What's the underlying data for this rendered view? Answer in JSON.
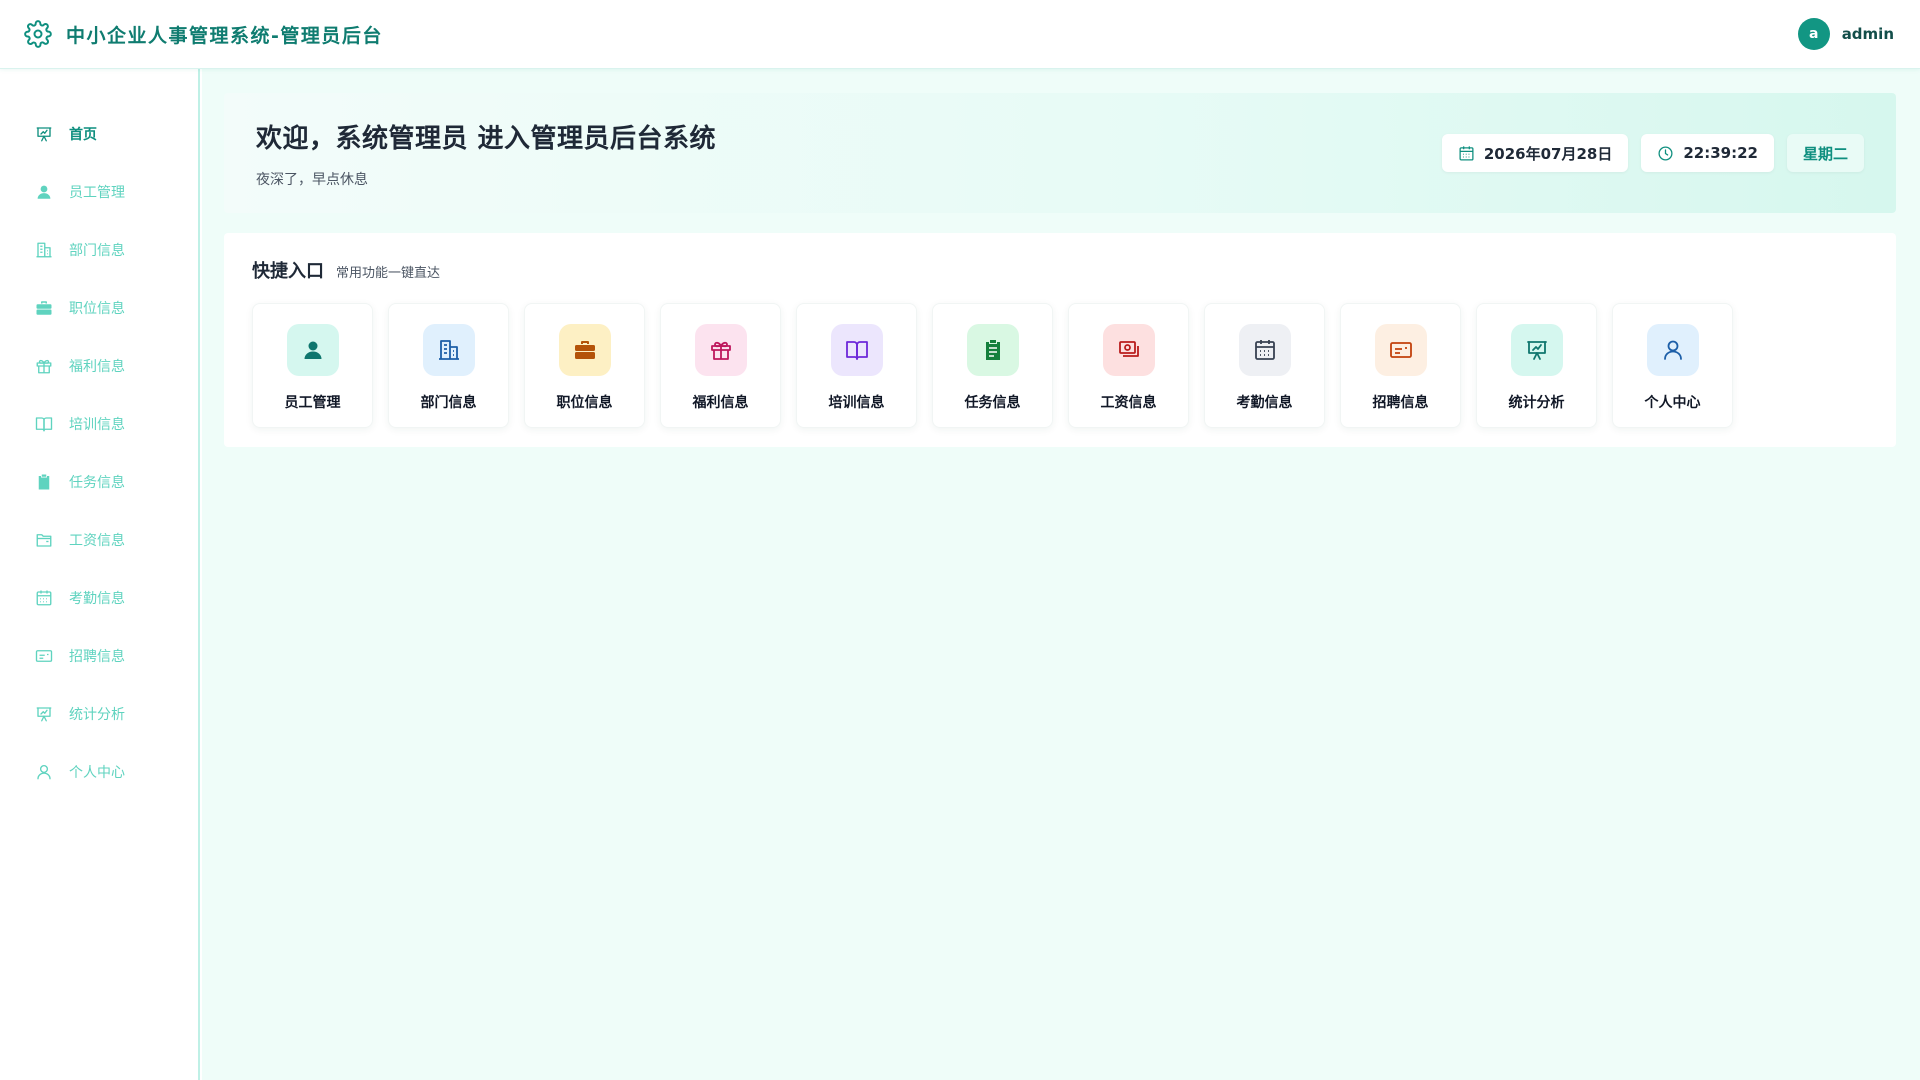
{
  "header": {
    "title": "中小企业人事管理系统-管理员后台",
    "logo_icon": "gear-icon",
    "avatar_letter": "a",
    "username": "admin"
  },
  "sidebar": {
    "items": [
      {
        "label": "首页",
        "icon": "presentation-chart-icon",
        "active": true
      },
      {
        "label": "员工管理",
        "icon": "user-icon"
      },
      {
        "label": "部门信息",
        "icon": "building-icon"
      },
      {
        "label": "职位信息",
        "icon": "briefcase-icon"
      },
      {
        "label": "福利信息",
        "icon": "gift-icon"
      },
      {
        "label": "培训信息",
        "icon": "book-icon"
      },
      {
        "label": "任务信息",
        "icon": "clipboard-icon"
      },
      {
        "label": "工资信息",
        "icon": "folder-icon"
      },
      {
        "label": "考勤信息",
        "icon": "calendar-icon"
      },
      {
        "label": "招聘信息",
        "icon": "id-card-icon"
      },
      {
        "label": "统计分析",
        "icon": "presentation-chart-icon"
      },
      {
        "label": "个人中心",
        "icon": "user-outline-icon"
      }
    ]
  },
  "welcome": {
    "title": "欢迎，系统管理员 进入管理员后台系统",
    "subtitle": "夜深了，早点休息",
    "date": "2026年07月28日",
    "time": "22:39:22",
    "weekday": "星期二"
  },
  "quick": {
    "title": "快捷入口",
    "subtitle": "常用功能一键直达",
    "tiles": [
      {
        "label": "员工管理",
        "icon": "user-icon",
        "bg": "#d5f7ef",
        "fg": "#0f766e"
      },
      {
        "label": "部门信息",
        "icon": "building-icon",
        "bg": "#e0f0fd",
        "fg": "#1d5fa8"
      },
      {
        "label": "职位信息",
        "icon": "briefcase-icon",
        "bg": "#fdf0c4",
        "fg": "#b45309"
      },
      {
        "label": "福利信息",
        "icon": "gift-icon",
        "bg": "#fce3ef",
        "fg": "#be185d"
      },
      {
        "label": "培训信息",
        "icon": "book-icon",
        "bg": "#ece6fd",
        "fg": "#6d28d9"
      },
      {
        "label": "任务信息",
        "icon": "clipboard-icon",
        "bg": "#d9f8e3",
        "fg": "#15803d"
      },
      {
        "label": "工资信息",
        "icon": "money-icon",
        "bg": "#fde0e0",
        "fg": "#b91c1c"
      },
      {
        "label": "考勤信息",
        "icon": "calendar-icon",
        "bg": "#eef0f4",
        "fg": "#374151"
      },
      {
        "label": "招聘信息",
        "icon": "id-card-icon",
        "bg": "#fdefe2",
        "fg": "#c2410c"
      },
      {
        "label": "统计分析",
        "icon": "presentation-chart-icon",
        "bg": "#d5f7ef",
        "fg": "#0f766e"
      },
      {
        "label": "个人中心",
        "icon": "user-outline-icon",
        "bg": "#e0f0fd",
        "fg": "#1d5fa8"
      }
    ]
  },
  "colors": {
    "accent": "#0f8f7f",
    "sidebar_text": "#5fd3bf",
    "main_bg": "#effdf9"
  }
}
